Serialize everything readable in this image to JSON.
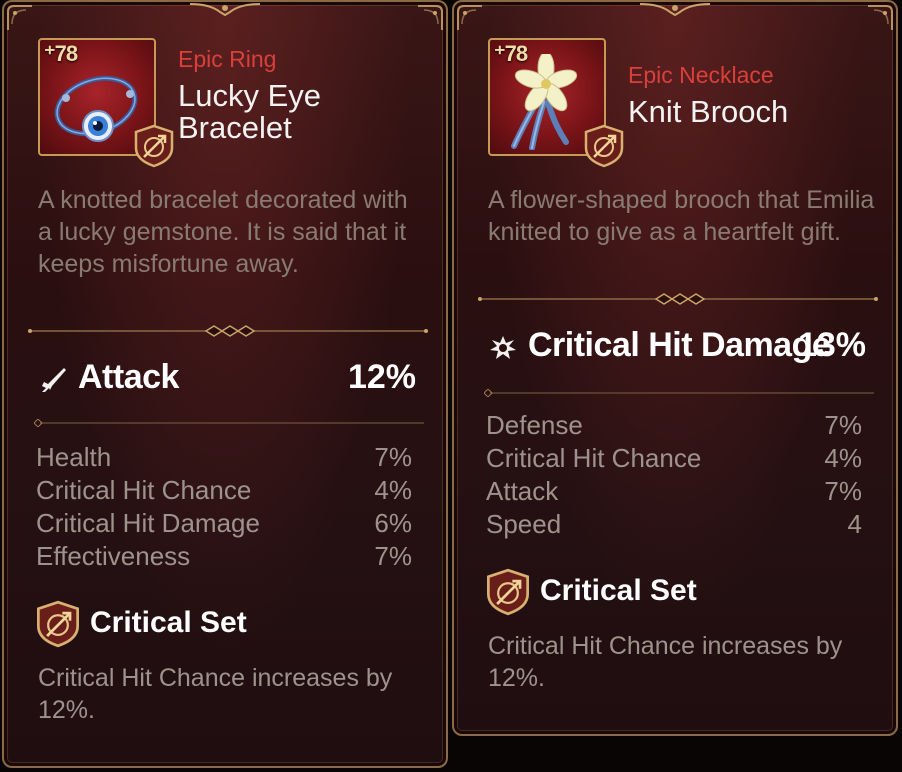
{
  "cards": [
    {
      "level": "78",
      "rarity": "Epic Ring",
      "name": "Lucky Eye Bracelet",
      "description": "A knotted bracelet decorated with a lucky gemstone. It is said that it keeps misfortune away.",
      "main_stat": {
        "label": "Attack",
        "value": "12%",
        "icon": "sword-icon"
      },
      "sub_stats": [
        {
          "label": "Health",
          "value": "7%"
        },
        {
          "label": "Critical Hit Chance",
          "value": "4%"
        },
        {
          "label": "Critical Hit Damage",
          "value": "6%"
        },
        {
          "label": "Effectiveness",
          "value": "7%"
        }
      ],
      "set": {
        "name": "Critical Set",
        "description": "Critical Hit Chance increases by 12%."
      }
    },
    {
      "level": "78",
      "rarity": "Epic Necklace",
      "name": "Knit Brooch",
      "description": "A flower-shaped brooch that Emilia knitted to give as a heartfelt gift.",
      "main_stat": {
        "label": "Critical Hit Damage",
        "value": "13%",
        "icon": "burst-icon"
      },
      "sub_stats": [
        {
          "label": "Defense",
          "value": "7%"
        },
        {
          "label": "Critical Hit Chance",
          "value": "4%"
        },
        {
          "label": "Attack",
          "value": "7%"
        },
        {
          "label": "Speed",
          "value": "4"
        }
      ],
      "set": {
        "name": "Critical Set",
        "description": "Critical Hit Chance increases by 12%."
      }
    }
  ],
  "colors": {
    "rarity_epic": "#d9403a",
    "frame_gold": "#c49a55",
    "text_muted": "#9e938c"
  }
}
